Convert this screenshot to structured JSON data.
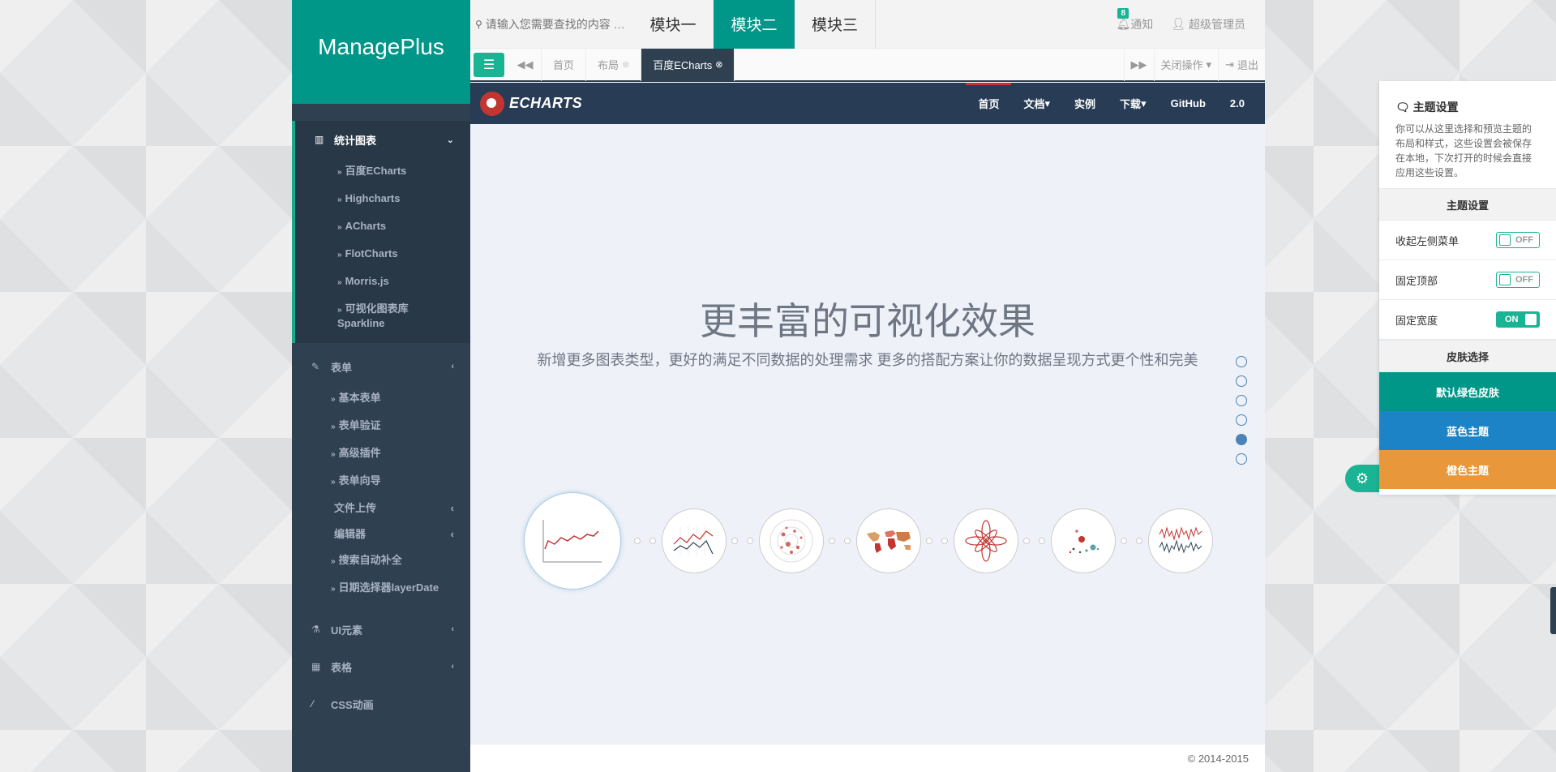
{
  "sidebar": {
    "logo": "ManagePlus",
    "groups": [
      {
        "label": "统计图表",
        "icon": "bar-chart-icon",
        "arrow": "⌄",
        "items": [
          "百度ECharts",
          "Highcharts",
          "ACharts",
          "FlotCharts",
          "Morris.js",
          "可视化图表库Sparkline"
        ]
      },
      {
        "label": "表单",
        "icon": "edit-icon",
        "arrow": "‹",
        "items": [
          "基本表单",
          "表单验证",
          "高级插件",
          "表单向导"
        ],
        "plain": [
          {
            "label": "文件上传",
            "arrow": "‹"
          },
          {
            "label": "编辑器",
            "arrow": "‹"
          }
        ],
        "items2": [
          "搜索自动补全",
          "日期选择器layerDate"
        ]
      },
      {
        "label": "UI元素",
        "icon": "flask-icon",
        "arrow": "‹"
      },
      {
        "label": "表格",
        "icon": "table-icon",
        "arrow": "‹"
      },
      {
        "label": "CSS动画",
        "icon": "magic-wand-icon",
        "arrow": ""
      }
    ]
  },
  "topbar": {
    "search_placeholder": "请输入您需要查找的内容 …",
    "modules": [
      "模块一",
      "模块二",
      "模块三"
    ],
    "active_module": 1,
    "notice_count": "8",
    "notice_label": "通知",
    "admin_label": "超级管理员"
  },
  "tabs": {
    "items": [
      "首页",
      "布局",
      "百度ECharts"
    ],
    "active": 2,
    "close_ops": "关闭操作",
    "logout": "退出"
  },
  "echarts": {
    "logo": "ECHARTS",
    "nav": [
      "首页",
      "文档",
      "实例",
      "下载",
      "GitHub",
      "2.0"
    ],
    "nav_dropdowns": [
      false,
      true,
      false,
      true,
      false,
      false
    ],
    "title": "更丰富的可视化效果",
    "subtitle": "新增更多图表类型，更好的满足不同数据的处理需求 更多的搭配方案让你的数据呈现方式更个性和完美",
    "dots_active": 4,
    "dots_count": 6
  },
  "footer": {
    "copyright": "© 2014-2015"
  },
  "theme": {
    "title": "主题设置",
    "desc": "你可以从这里选择和预览主题的布局和样式，这些设置会被保存在本地，下次打开的时候会直接应用这些设置。",
    "section1": "主题设置",
    "options": [
      {
        "label": "收起左侧菜单",
        "state": "OFF"
      },
      {
        "label": "固定顶部",
        "state": "OFF"
      },
      {
        "label": "固定宽度",
        "state": "ON"
      }
    ],
    "section2": "皮肤选择",
    "skins": [
      {
        "label": "默认绿色皮肤",
        "color": "#009688"
      },
      {
        "label": "蓝色主题",
        "color": "#1c84c6"
      },
      {
        "label": "橙色主题",
        "color": "#e8973a"
      }
    ]
  },
  "colors": {
    "accent": "#009688",
    "sidebar": "#2f4050",
    "echarts_nav": "#293c55",
    "echarts_red": "#c23531"
  }
}
